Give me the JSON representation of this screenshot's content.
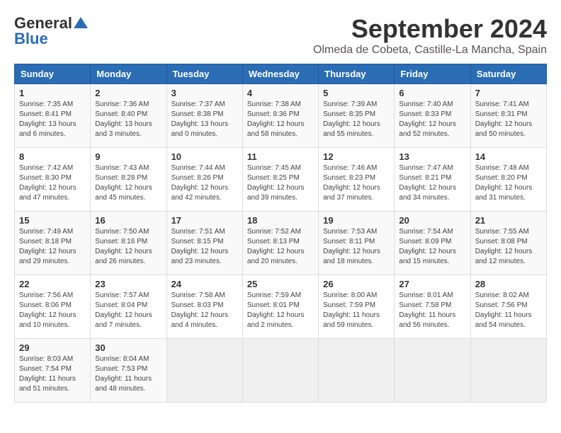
{
  "header": {
    "logo_line1": "General",
    "logo_line2": "Blue",
    "month": "September 2024",
    "location": "Olmeda de Cobeta, Castille-La Mancha, Spain"
  },
  "weekdays": [
    "Sunday",
    "Monday",
    "Tuesday",
    "Wednesday",
    "Thursday",
    "Friday",
    "Saturday"
  ],
  "weeks": [
    [
      {
        "day": "1",
        "sunrise": "Sunrise: 7:35 AM",
        "sunset": "Sunset: 8:41 PM",
        "daylight": "Daylight: 13 hours and 6 minutes."
      },
      {
        "day": "2",
        "sunrise": "Sunrise: 7:36 AM",
        "sunset": "Sunset: 8:40 PM",
        "daylight": "Daylight: 13 hours and 3 minutes."
      },
      {
        "day": "3",
        "sunrise": "Sunrise: 7:37 AM",
        "sunset": "Sunset: 8:38 PM",
        "daylight": "Daylight: 13 hours and 0 minutes."
      },
      {
        "day": "4",
        "sunrise": "Sunrise: 7:38 AM",
        "sunset": "Sunset: 8:36 PM",
        "daylight": "Daylight: 12 hours and 58 minutes."
      },
      {
        "day": "5",
        "sunrise": "Sunrise: 7:39 AM",
        "sunset": "Sunset: 8:35 PM",
        "daylight": "Daylight: 12 hours and 55 minutes."
      },
      {
        "day": "6",
        "sunrise": "Sunrise: 7:40 AM",
        "sunset": "Sunset: 8:33 PM",
        "daylight": "Daylight: 12 hours and 52 minutes."
      },
      {
        "day": "7",
        "sunrise": "Sunrise: 7:41 AM",
        "sunset": "Sunset: 8:31 PM",
        "daylight": "Daylight: 12 hours and 50 minutes."
      }
    ],
    [
      {
        "day": "8",
        "sunrise": "Sunrise: 7:42 AM",
        "sunset": "Sunset: 8:30 PM",
        "daylight": "Daylight: 12 hours and 47 minutes."
      },
      {
        "day": "9",
        "sunrise": "Sunrise: 7:43 AM",
        "sunset": "Sunset: 8:28 PM",
        "daylight": "Daylight: 12 hours and 45 minutes."
      },
      {
        "day": "10",
        "sunrise": "Sunrise: 7:44 AM",
        "sunset": "Sunset: 8:26 PM",
        "daylight": "Daylight: 12 hours and 42 minutes."
      },
      {
        "day": "11",
        "sunrise": "Sunrise: 7:45 AM",
        "sunset": "Sunset: 8:25 PM",
        "daylight": "Daylight: 12 hours and 39 minutes."
      },
      {
        "day": "12",
        "sunrise": "Sunrise: 7:46 AM",
        "sunset": "Sunset: 8:23 PM",
        "daylight": "Daylight: 12 hours and 37 minutes."
      },
      {
        "day": "13",
        "sunrise": "Sunrise: 7:47 AM",
        "sunset": "Sunset: 8:21 PM",
        "daylight": "Daylight: 12 hours and 34 minutes."
      },
      {
        "day": "14",
        "sunrise": "Sunrise: 7:48 AM",
        "sunset": "Sunset: 8:20 PM",
        "daylight": "Daylight: 12 hours and 31 minutes."
      }
    ],
    [
      {
        "day": "15",
        "sunrise": "Sunrise: 7:49 AM",
        "sunset": "Sunset: 8:18 PM",
        "daylight": "Daylight: 12 hours and 29 minutes."
      },
      {
        "day": "16",
        "sunrise": "Sunrise: 7:50 AM",
        "sunset": "Sunset: 8:16 PM",
        "daylight": "Daylight: 12 hours and 26 minutes."
      },
      {
        "day": "17",
        "sunrise": "Sunrise: 7:51 AM",
        "sunset": "Sunset: 8:15 PM",
        "daylight": "Daylight: 12 hours and 23 minutes."
      },
      {
        "day": "18",
        "sunrise": "Sunrise: 7:52 AM",
        "sunset": "Sunset: 8:13 PM",
        "daylight": "Daylight: 12 hours and 20 minutes."
      },
      {
        "day": "19",
        "sunrise": "Sunrise: 7:53 AM",
        "sunset": "Sunset: 8:11 PM",
        "daylight": "Daylight: 12 hours and 18 minutes."
      },
      {
        "day": "20",
        "sunrise": "Sunrise: 7:54 AM",
        "sunset": "Sunset: 8:09 PM",
        "daylight": "Daylight: 12 hours and 15 minutes."
      },
      {
        "day": "21",
        "sunrise": "Sunrise: 7:55 AM",
        "sunset": "Sunset: 8:08 PM",
        "daylight": "Daylight: 12 hours and 12 minutes."
      }
    ],
    [
      {
        "day": "22",
        "sunrise": "Sunrise: 7:56 AM",
        "sunset": "Sunset: 8:06 PM",
        "daylight": "Daylight: 12 hours and 10 minutes."
      },
      {
        "day": "23",
        "sunrise": "Sunrise: 7:57 AM",
        "sunset": "Sunset: 8:04 PM",
        "daylight": "Daylight: 12 hours and 7 minutes."
      },
      {
        "day": "24",
        "sunrise": "Sunrise: 7:58 AM",
        "sunset": "Sunset: 8:03 PM",
        "daylight": "Daylight: 12 hours and 4 minutes."
      },
      {
        "day": "25",
        "sunrise": "Sunrise: 7:59 AM",
        "sunset": "Sunset: 8:01 PM",
        "daylight": "Daylight: 12 hours and 2 minutes."
      },
      {
        "day": "26",
        "sunrise": "Sunrise: 8:00 AM",
        "sunset": "Sunset: 7:59 PM",
        "daylight": "Daylight: 11 hours and 59 minutes."
      },
      {
        "day": "27",
        "sunrise": "Sunrise: 8:01 AM",
        "sunset": "Sunset: 7:58 PM",
        "daylight": "Daylight: 11 hours and 56 minutes."
      },
      {
        "day": "28",
        "sunrise": "Sunrise: 8:02 AM",
        "sunset": "Sunset: 7:56 PM",
        "daylight": "Daylight: 11 hours and 54 minutes."
      }
    ],
    [
      {
        "day": "29",
        "sunrise": "Sunrise: 8:03 AM",
        "sunset": "Sunset: 7:54 PM",
        "daylight": "Daylight: 11 hours and 51 minutes."
      },
      {
        "day": "30",
        "sunrise": "Sunrise: 8:04 AM",
        "sunset": "Sunset: 7:53 PM",
        "daylight": "Daylight: 11 hours and 48 minutes."
      },
      null,
      null,
      null,
      null,
      null
    ]
  ]
}
